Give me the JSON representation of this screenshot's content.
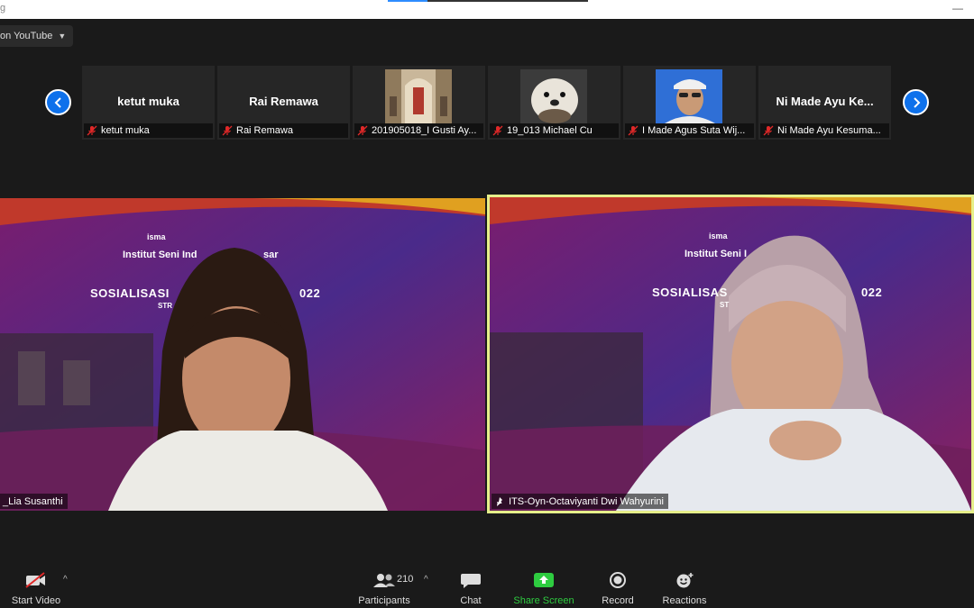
{
  "window": {
    "title": "g"
  },
  "live": {
    "label": "on YouTube"
  },
  "thumbnails": [
    {
      "big_name": "ketut muka",
      "label": "ketut muka",
      "photo": ""
    },
    {
      "big_name": "Rai Remawa",
      "label": "Rai Remawa",
      "photo": ""
    },
    {
      "big_name": "",
      "label": "201905018_I Gusti Ay...",
      "photo": "temple"
    },
    {
      "big_name": "",
      "label": "19_013 Michael Cu",
      "photo": "otter"
    },
    {
      "big_name": "",
      "label": "I Made Agus Suta Wij...",
      "photo": "person"
    },
    {
      "big_name": "Ni Made Ayu Ke...",
      "label": "Ni Made Ayu Kesuma...",
      "photo": ""
    }
  ],
  "videos": {
    "left": {
      "name": "_Lia Susanthi",
      "slide_logo": "isma",
      "slide_line1": "Institut Seni Ind",
      "slide_line1b": "sar",
      "slide_title": "SOSIALISASI",
      "slide_title_b": "022",
      "slide_sub": "STR"
    },
    "right": {
      "name": "ITS-Oyn-Octaviyanti Dwi Wahyurini",
      "slide_logo": "isma",
      "slide_line1": "Institut Seni I",
      "slide_title": "SOSIALISAS",
      "slide_title_b": "022",
      "slide_sub": "ST"
    }
  },
  "toolbar": {
    "start_video": "Start Video",
    "participants": "Participants",
    "participants_count": "210",
    "chat": "Chat",
    "share_screen": "Share Screen",
    "record": "Record",
    "reactions": "Reactions"
  },
  "colors": {
    "accent": "#0e71eb",
    "share_green": "#2ecc40",
    "speaker_border": "#e6ef8a",
    "mic_off_red": "#e02828"
  }
}
